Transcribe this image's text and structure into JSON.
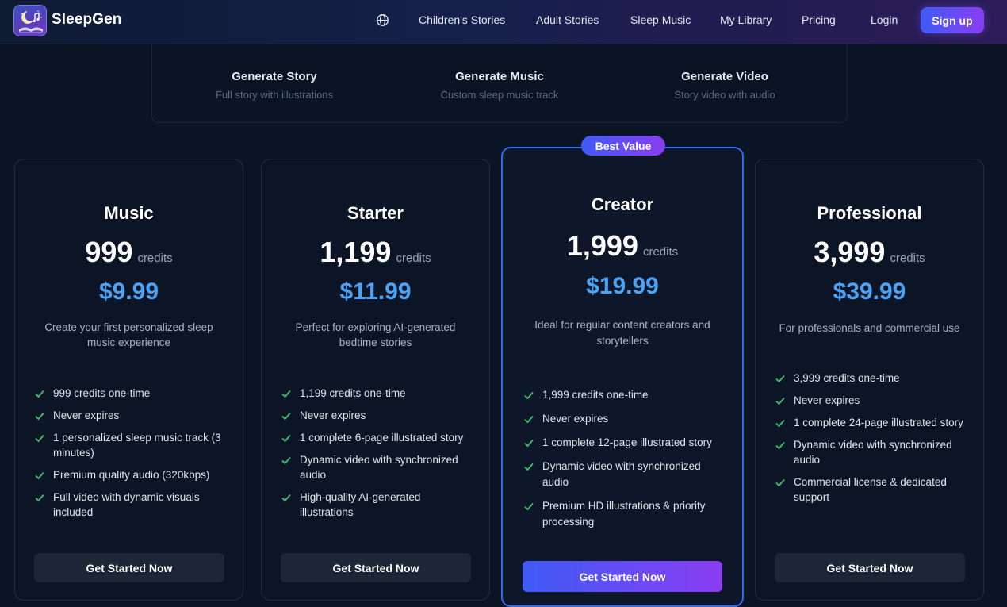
{
  "header": {
    "brand": "SleepGen",
    "nav": [
      "Children's Stories",
      "Adult Stories",
      "Sleep Music",
      "My Library",
      "Pricing"
    ],
    "login": "Login",
    "signup": "Sign up"
  },
  "generate": [
    {
      "title": "Generate Story",
      "subtitle": "Full story with illustrations"
    },
    {
      "title": "Generate Music",
      "subtitle": "Custom sleep music track"
    },
    {
      "title": "Generate Video",
      "subtitle": "Story video with audio"
    }
  ],
  "badge": "Best Value",
  "credits_word": "credits",
  "plans": [
    {
      "name": "Music",
      "credits": "999",
      "price": "$9.99",
      "description": "Create your first personalized sleep music experience",
      "features": [
        "999 credits one-time",
        "Never expires",
        "1 personalized sleep music track (3 minutes)",
        "Premium quality audio (320kbps)",
        "Full video with dynamic visuals included"
      ],
      "cta": "Get Started Now"
    },
    {
      "name": "Starter",
      "credits": "1,199",
      "price": "$11.99",
      "description": "Perfect for exploring AI-generated bedtime stories",
      "features": [
        "1,199 credits one-time",
        "Never expires",
        "1 complete 6-page illustrated story",
        "Dynamic video with synchronized audio",
        "High-quality AI-generated illustrations"
      ],
      "cta": "Get Started Now"
    },
    {
      "name": "Creator",
      "credits": "1,999",
      "price": "$19.99",
      "description": "Ideal for regular content creators and storytellers",
      "features": [
        "1,999 credits one-time",
        "Never expires",
        "1 complete 12-page illustrated story",
        "Dynamic video with synchronized audio",
        "Premium HD illustrations & priority processing"
      ],
      "cta": "Get Started Now"
    },
    {
      "name": "Professional",
      "credits": "3,999",
      "price": "$39.99",
      "description": "For professionals and commercial use",
      "features": [
        "3,999 credits one-time",
        "Never expires",
        "1 complete 24-page illustrated story",
        "Dynamic video with synchronized audio",
        "Commercial license & dedicated support"
      ],
      "cta": "Get Started Now"
    }
  ],
  "colors": {
    "accent_blue": "#4aa3f5",
    "gradient_start": "#3f5bf6",
    "gradient_end": "#8a3df0",
    "check_green": "#3fbf6f",
    "background": "#0b1424"
  },
  "icons": {
    "logo": "moon-book-music-logo",
    "language": "globe-icon",
    "feature": "check-icon"
  }
}
